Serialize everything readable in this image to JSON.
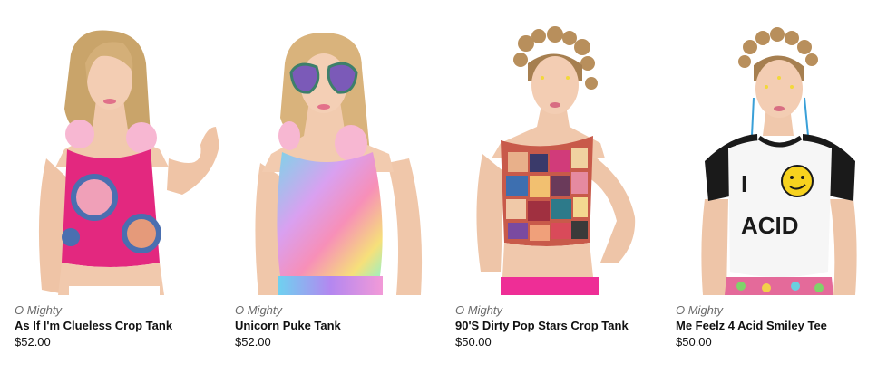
{
  "colors": {
    "brand_text": "#6b6b6b",
    "name_text": "#111111",
    "price_text": "#111111",
    "background": "#ffffff"
  },
  "products": [
    {
      "brand": "O Mighty",
      "name": "As If I'm Clueless Crop Tank",
      "price": "$52.00",
      "image_alt": "model wearing pink crop tank with portrait print and pink fur earrings"
    },
    {
      "brand": "O Mighty",
      "name": "Unicorn Puke Tank",
      "price": "$52.00",
      "image_alt": "model wearing rainbow gradient tank and heart sunglasses"
    },
    {
      "brand": "O Mighty",
      "name": "90'S Dirty Pop Stars Crop Tank",
      "price": "$50.00",
      "image_alt": "model wearing collage print crop tank with space buns"
    },
    {
      "brand": "O Mighty",
      "name": "Me Feelz 4 Acid Smiley Tee",
      "price": "$50.00",
      "image_alt": "model wearing white raglan tee with I smiley ACID print"
    }
  ],
  "tee_print": {
    "line1": "I",
    "line2": "ACID"
  }
}
